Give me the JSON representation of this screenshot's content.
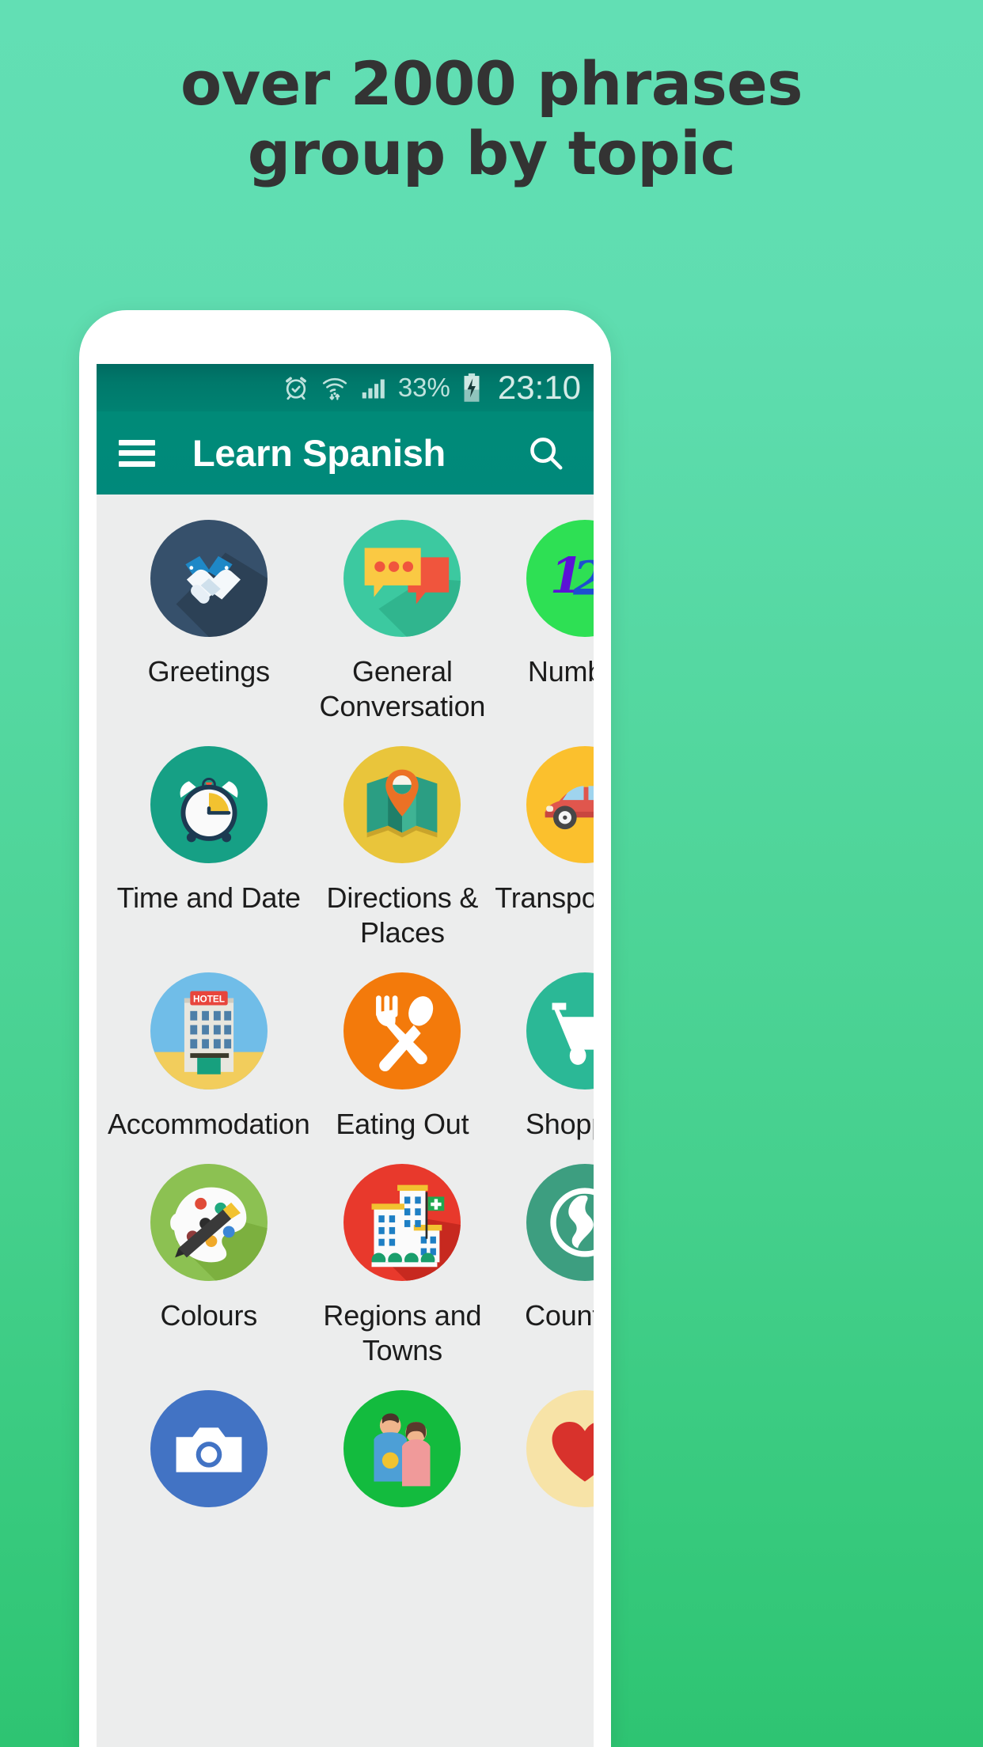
{
  "promo": {
    "line1": "over 2000 phrases",
    "line2": "group by topic",
    "bg_gradient_top": "#62dfb4",
    "bg_gradient_bottom": "#2ec472",
    "text_color": "#333333"
  },
  "statusbar": {
    "alarm_icon": "alarm-clock-icon",
    "wifi_icon": "wifi-transfer-icon",
    "signal_icon": "cellular-signal-icon",
    "battery_percent": "33%",
    "battery_icon": "battery-charging-icon",
    "time": "23:10",
    "bg_color": "#00796b",
    "text_color": "#bfe2dd"
  },
  "appbar": {
    "menu_icon": "hamburger-menu-icon",
    "title": "Learn Spanish",
    "search_icon": "search-icon",
    "bg_color": "#00897b",
    "title_color": "#ffffff"
  },
  "grid": {
    "bg_color": "#eceded",
    "tiles": [
      {
        "label": "Greetings",
        "icon": "handshake-icon",
        "circle_color": "#36506b"
      },
      {
        "label": "General Conversation",
        "icon": "speech-bubbles-icon",
        "circle_color": "#3cc9a0"
      },
      {
        "label": "Numbers",
        "icon": "one-two-three-icon",
        "circle_color": "#2ee054"
      },
      {
        "label": "Time and Date",
        "icon": "alarm-clock-icon",
        "circle_color": "#16a085"
      },
      {
        "label": "Directions & Places",
        "icon": "folded-map-pin-icon",
        "circle_color": "#e9c53b"
      },
      {
        "label": "Transportation",
        "icon": "car-icon",
        "circle_color": "#fbc02d"
      },
      {
        "label": "Accommodation",
        "icon": "hotel-building-icon",
        "circle_color": "#70bde8"
      },
      {
        "label": "Eating Out",
        "icon": "fork-spoon-icon",
        "circle_color": "#f37a0b"
      },
      {
        "label": "Shopping",
        "icon": "shopping-cart-icon",
        "circle_color": "#2bb896"
      },
      {
        "label": "Colours",
        "icon": "paint-palette-icon",
        "circle_color": "#8cc152"
      },
      {
        "label": "Regions and Towns",
        "icon": "city-buildings-icon",
        "circle_color": "#e8392c"
      },
      {
        "label": "Countries",
        "icon": "globe-icon",
        "circle_color": "#3d9e80"
      },
      {
        "label": "",
        "icon": "camera-icon",
        "circle_color": "#4273c4"
      },
      {
        "label": "",
        "icon": "couple-icon",
        "circle_color": "#13bb3e"
      },
      {
        "label": "",
        "icon": "heart-arrow-icon",
        "circle_color": "#f7e3a7"
      }
    ]
  }
}
